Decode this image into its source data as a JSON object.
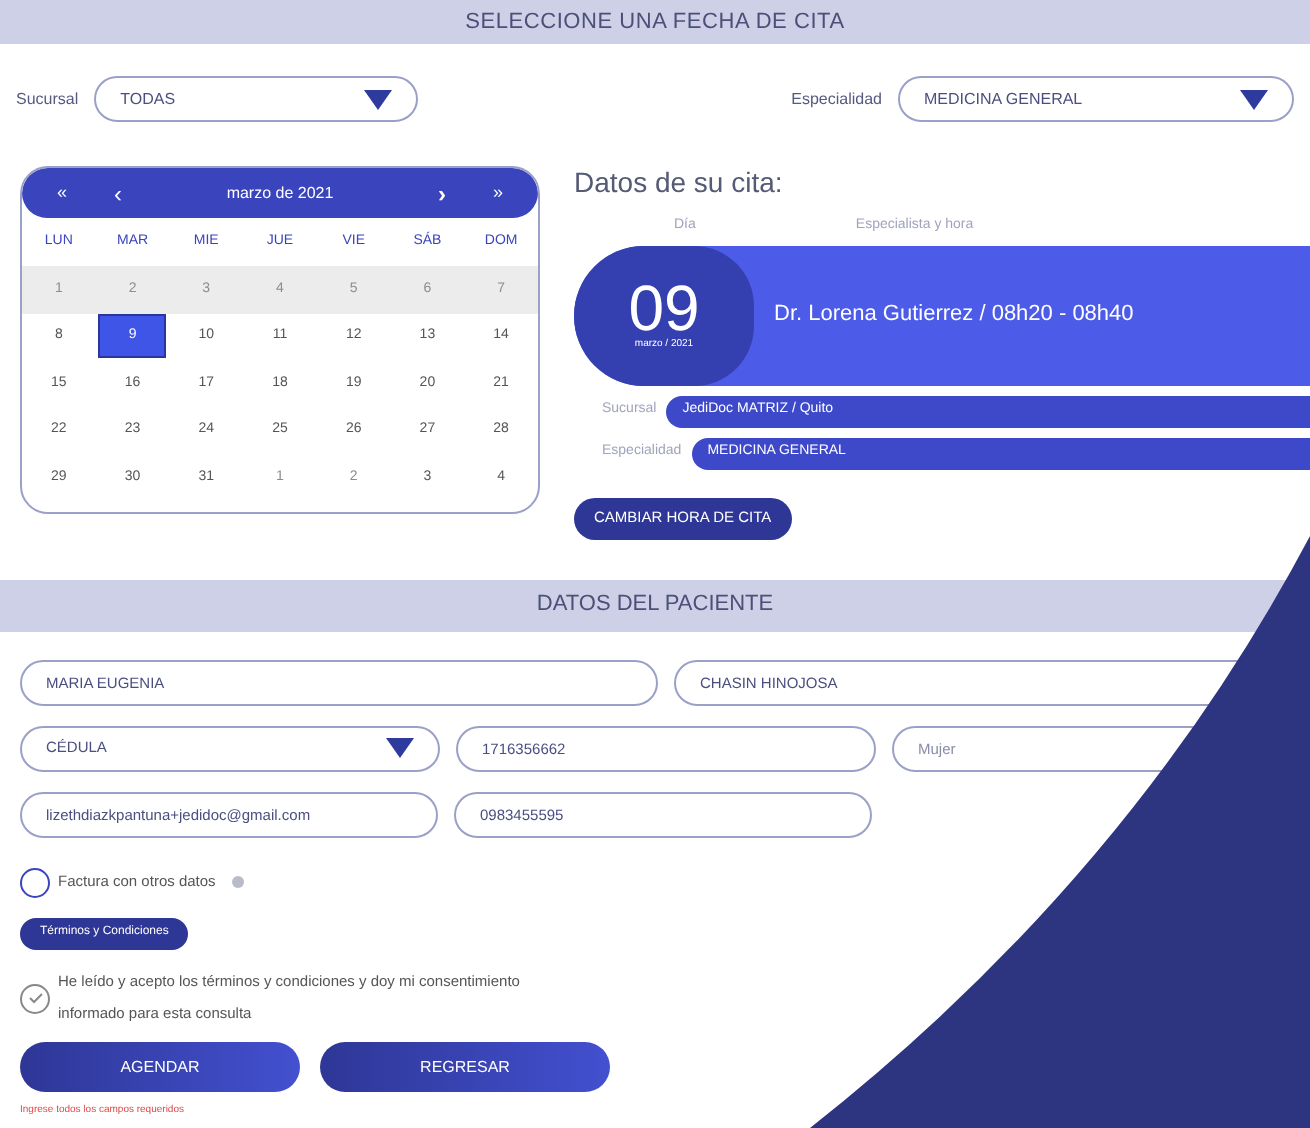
{
  "appointment_section": {
    "title": "SELECCIONE UNA FECHA DE CITA"
  },
  "filters": [
    {
      "label": "Sucursal",
      "value": "TODAS"
    },
    {
      "label": "Especialidad",
      "value": "MEDICINA GENERAL"
    }
  ],
  "calendar": {
    "nav_first": "«",
    "nav_prev": "‹",
    "month": "marzo de 2021",
    "nav_next": "›",
    "nav_last": "»",
    "weekdays": [
      "LUN",
      "MAR",
      "MIE",
      "JUE",
      "VIE",
      "SÁB",
      "DOM"
    ],
    "weeks": [
      [
        {
          "label": "1",
          "disabled": true,
          "selected": false
        },
        {
          "label": "2",
          "disabled": true,
          "selected": false
        },
        {
          "label": "3",
          "disabled": true,
          "selected": false
        },
        {
          "label": "4",
          "disabled": true,
          "selected": false
        },
        {
          "label": "5",
          "disabled": true,
          "selected": false
        },
        {
          "label": "6",
          "disabled": true,
          "selected": false
        },
        {
          "label": "7",
          "disabled": true,
          "selected": false
        }
      ],
      [
        {
          "label": "8",
          "disabled": false,
          "selected": false
        },
        {
          "label": "9",
          "disabled": false,
          "selected": true
        },
        {
          "label": "10",
          "disabled": false,
          "selected": false
        },
        {
          "label": "11",
          "disabled": false,
          "selected": false
        },
        {
          "label": "12",
          "disabled": false,
          "selected": false
        },
        {
          "label": "13",
          "disabled": false,
          "selected": false
        },
        {
          "label": "14",
          "disabled": false,
          "selected": false
        }
      ],
      [
        {
          "label": "15",
          "disabled": false,
          "selected": false
        },
        {
          "label": "16",
          "disabled": false,
          "selected": false
        },
        {
          "label": "17",
          "disabled": false,
          "selected": false
        },
        {
          "label": "18",
          "disabled": false,
          "selected": false
        },
        {
          "label": "19",
          "disabled": false,
          "selected": false
        },
        {
          "label": "20",
          "disabled": false,
          "selected": false
        },
        {
          "label": "21",
          "disabled": false,
          "selected": false
        }
      ],
      [
        {
          "label": "22",
          "disabled": false,
          "selected": false
        },
        {
          "label": "23",
          "disabled": false,
          "selected": false
        },
        {
          "label": "24",
          "disabled": false,
          "selected": false
        },
        {
          "label": "25",
          "disabled": false,
          "selected": false
        },
        {
          "label": "26",
          "disabled": false,
          "selected": false
        },
        {
          "label": "27",
          "disabled": false,
          "selected": false
        },
        {
          "label": "28",
          "disabled": false,
          "selected": false
        }
      ],
      [
        {
          "label": "29",
          "disabled": false,
          "selected": false
        },
        {
          "label": "30",
          "disabled": false,
          "selected": false
        },
        {
          "label": "31",
          "disabled": false,
          "selected": false
        },
        {
          "label": "1",
          "disabled": true,
          "selected": false
        },
        {
          "label": "2",
          "disabled": true,
          "selected": false
        },
        {
          "label": "3",
          "disabled": false,
          "selected": false
        },
        {
          "label": "4",
          "disabled": false,
          "selected": false
        }
      ]
    ]
  },
  "summary": {
    "title": "Datos de su cita:",
    "day_header": "Día",
    "specialist_header": "Especialista y hora",
    "day": "09",
    "month_year": "marzo / 2021",
    "specialist_time": "Dr. Lorena Gutierrez / 08h20 - 08h40",
    "details": [
      {
        "label": "Sucursal",
        "value": "JediDoc MATRIZ / Quito"
      },
      {
        "label": "Especialidad",
        "value": "MEDICINA GENERAL"
      }
    ],
    "change_button": "CAMBIAR HORA DE CITA"
  },
  "patient_section": {
    "title": "DATOS DEL PACIENTE"
  },
  "patient_rows": [
    [
      {
        "kind": "text",
        "value": "MARIA EUGENIA"
      },
      {
        "kind": "text",
        "value": "CHASIN HINOJOSA"
      }
    ],
    [
      {
        "kind": "select",
        "value": "CÉDULA"
      },
      {
        "kind": "text",
        "value": "1716356662"
      },
      {
        "kind": "text",
        "placeholder": "Mujer"
      }
    ],
    [
      {
        "kind": "text",
        "value": "lizethdiazkpantuna+jedidoc@gmail.com"
      },
      {
        "kind": "text",
        "value": "0983455595"
      }
    ]
  ],
  "invoice_option": {
    "label": "Factura con otros datos",
    "checked": false
  },
  "terms_button": "Términos y Condiciones",
  "consent": {
    "label": "He leído y acepto los términos y condiciones y doy mi consentimiento informado para esta consulta",
    "checked": true
  },
  "buttons": [
    "AGENDAR",
    "REGRESAR"
  ],
  "error": "Ingrese todos los campos requeridos"
}
